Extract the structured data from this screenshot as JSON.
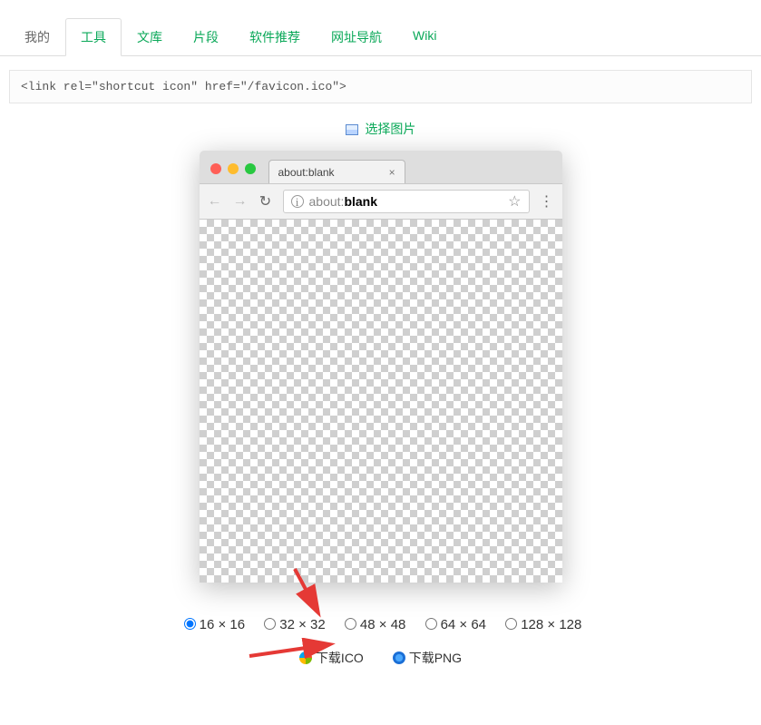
{
  "tabs": {
    "items": [
      "我的",
      "工具",
      "文库",
      "片段",
      "软件推荐",
      "网址导航",
      "Wiki"
    ],
    "activeIndex": 1
  },
  "codeSnippet": "<link rel=\"shortcut icon\" href=\"/favicon.ico\">",
  "selectImage": "选择图片",
  "browser": {
    "tabTitle": "about:blank",
    "urlPrefix": "about:",
    "urlMain": "blank"
  },
  "sizes": {
    "options": [
      "16 × 16",
      "32 × 32",
      "48 × 48",
      "64 × 64",
      "128 × 128"
    ],
    "selectedIndex": 0
  },
  "downloads": {
    "ico": "下载ICO",
    "png": "下载PNG"
  }
}
